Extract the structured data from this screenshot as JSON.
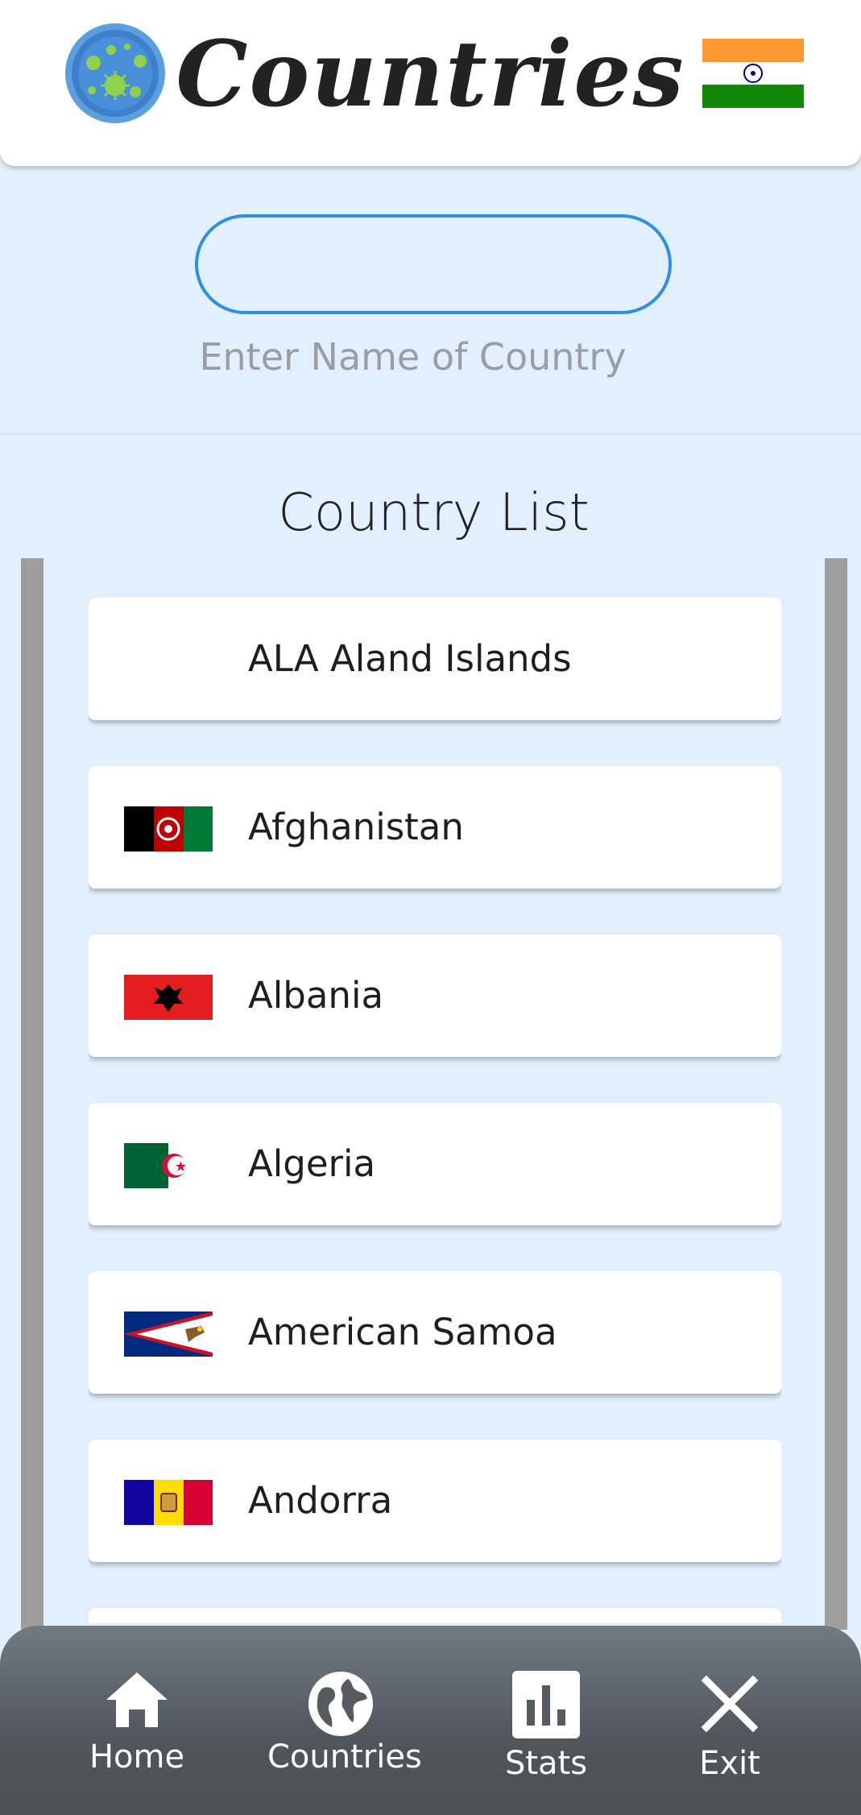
{
  "header": {
    "title": "Countries",
    "logo_icon": "virus-globe-icon",
    "flag_icon": "india-flag-icon"
  },
  "search": {
    "value": "",
    "hint": "Enter Name of Country"
  },
  "list": {
    "title": "Country List",
    "items": [
      {
        "name": "ALA Aland Islands",
        "flag": "none"
      },
      {
        "name": "Afghanistan",
        "flag": "afghanistan-flag-icon"
      },
      {
        "name": "Albania",
        "flag": "albania-flag-icon"
      },
      {
        "name": "Algeria",
        "flag": "algeria-flag-icon"
      },
      {
        "name": "American Samoa",
        "flag": "american-samoa-flag-icon"
      },
      {
        "name": "Andorra",
        "flag": "andorra-flag-icon"
      }
    ]
  },
  "nav": {
    "items": [
      {
        "label": "Home",
        "icon": "home-icon"
      },
      {
        "label": "Countries",
        "icon": "globe-icon"
      },
      {
        "label": "Stats",
        "icon": "bar-chart-icon"
      },
      {
        "label": "Exit",
        "icon": "close-icon"
      }
    ]
  },
  "colors": {
    "background": "#e1f0fc",
    "accent": "#2f8fe2",
    "nav": "#555b61"
  }
}
